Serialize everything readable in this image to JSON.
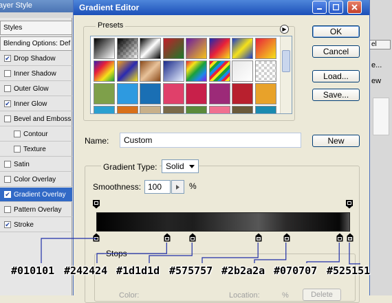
{
  "layer_style": {
    "title": "ayer Style",
    "styles_header": "Styles",
    "blending_options": "Blending Options: Def",
    "items": [
      {
        "label": "Drop Shadow",
        "checked": true
      },
      {
        "label": "Inner Shadow",
        "checked": false
      },
      {
        "label": "Outer Glow",
        "checked": false
      },
      {
        "label": "Inner Glow",
        "checked": true
      },
      {
        "label": "Bevel and Emboss",
        "checked": false
      },
      {
        "label": "Contour",
        "checked": false
      },
      {
        "label": "Texture",
        "checked": false
      },
      {
        "label": "Satin",
        "checked": false
      },
      {
        "label": "Color Overlay",
        "checked": false
      },
      {
        "label": "Gradient Overlay",
        "checked": true
      },
      {
        "label": "Pattern Overlay",
        "checked": false
      },
      {
        "label": "Stroke",
        "checked": true
      }
    ]
  },
  "right_window": {
    "btn1": "el",
    "btn2": "e...",
    "text1": "ew"
  },
  "gradient_editor": {
    "title": "Gradient Editor",
    "presets_label": "Presets",
    "buttons": {
      "ok": "OK",
      "cancel": "Cancel",
      "load": "Load...",
      "save": "Save...",
      "new": "New"
    },
    "name_label": "Name:",
    "name_value": "Custom",
    "gradient_type_label": "Gradient Type:",
    "gradient_type_value": "Solid",
    "smoothness_label": "Smoothness:",
    "smoothness_value": "100",
    "smoothness_unit": "%",
    "stops_label": "Stops",
    "color_label": "Color:",
    "location_label": "Location:",
    "location_unit": "%",
    "delete_label": "Delete"
  },
  "color_stops": [
    {
      "color": "#010101",
      "location_pct": 0,
      "label": "#010101"
    },
    {
      "color": "#242424",
      "location_pct": 28,
      "label": "#242424"
    },
    {
      "color": "#1d1d1d",
      "location_pct": 38,
      "label": "#1d1d1d"
    },
    {
      "color": "#575757",
      "location_pct": 64,
      "label": "#575757"
    },
    {
      "color": "#2b2a2a",
      "location_pct": 75,
      "label": "#2b2a2a"
    },
    {
      "color": "#070707",
      "location_pct": 96,
      "label": "#070707"
    },
    {
      "color": "#525151",
      "location_pct": 100,
      "label": "#525151"
    }
  ],
  "colors": {
    "titlebar": "#1b4fb8",
    "dialog_bg": "#ece9d8",
    "selected_row": "#3169c6",
    "callout_line": "#1f2fa8"
  }
}
